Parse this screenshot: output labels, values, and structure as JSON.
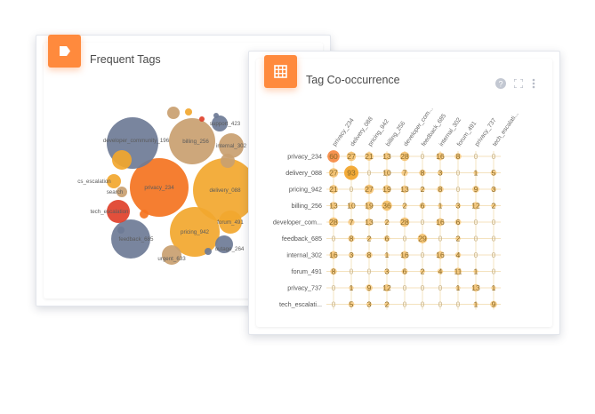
{
  "colors": {
    "accent": "#ff8a3d",
    "orange_deep": "#f4731f",
    "amber": "#f2a72e",
    "tan": "#c99f70",
    "slate": "#6e7b96",
    "red": "#e0402a"
  },
  "tags_card": {
    "title": "Frequent Tags",
    "icon": "tag-icon",
    "bubbles": [
      {
        "label": "privacy_234",
        "color": "orange_deep"
      },
      {
        "label": "delivery_088",
        "color": "amber"
      },
      {
        "label": "developer_community_196",
        "color": "slate"
      },
      {
        "label": "billing_256",
        "color": "tan"
      },
      {
        "label": "pricing_942",
        "color": "amber"
      },
      {
        "label": "feedback_685",
        "color": "slate"
      },
      {
        "label": "internal_302",
        "color": "tan"
      },
      {
        "label": "tech_escalation",
        "color": "red"
      },
      {
        "label": "forum_491",
        "color": "amber"
      },
      {
        "label": "cs_escalation",
        "color": "amber"
      },
      {
        "label": "search",
        "color": "tan"
      },
      {
        "label": "urgent_633",
        "color": "tan"
      },
      {
        "label": "support_423",
        "color": "slate"
      },
      {
        "label": "outage_264",
        "color": "slate"
      },
      {
        "label": "",
        "color": "amber"
      },
      {
        "label": "",
        "color": "tan"
      },
      {
        "label": "",
        "color": "amber"
      },
      {
        "label": "",
        "color": "slate"
      },
      {
        "label": "",
        "color": "red"
      },
      {
        "label": "",
        "color": "orange_deep"
      },
      {
        "label": "",
        "color": "slate"
      },
      {
        "label": "",
        "color": "tan"
      },
      {
        "label": "",
        "color": "slate"
      }
    ]
  },
  "cooc_card": {
    "title": "Tag Co-occurrence",
    "icon": "grid-icon",
    "toolbar": {
      "help_icon": "help-icon",
      "fullscreen_icon": "fullscreen-icon",
      "menu_icon": "more-vertical-icon"
    },
    "rows": [
      "privacy_234",
      "delivery_088",
      "pricing_942",
      "billing_256",
      "developer_com...",
      "feedback_685",
      "internal_302",
      "forum_491",
      "privacy_737",
      "tech_escalati..."
    ],
    "columns": [
      "privacy_234",
      "delivery_088",
      "pricing_942",
      "billing_256",
      "developer_com...",
      "feedback_685",
      "internal_302",
      "forum_491",
      "privacy_737",
      "tech_escalati..."
    ],
    "values": [
      [
        60,
        27,
        21,
        13,
        28,
        0,
        16,
        8,
        0,
        0
      ],
      [
        27,
        93,
        0,
        10,
        7,
        8,
        3,
        0,
        1,
        5
      ],
      [
        21,
        0,
        27,
        19,
        13,
        2,
        8,
        0,
        9,
        3
      ],
      [
        13,
        10,
        19,
        36,
        2,
        6,
        1,
        3,
        12,
        2
      ],
      [
        28,
        7,
        13,
        2,
        28,
        0,
        16,
        6,
        0,
        0
      ],
      [
        0,
        8,
        2,
        6,
        0,
        29,
        0,
        2,
        0,
        0
      ],
      [
        16,
        3,
        8,
        1,
        16,
        0,
        16,
        4,
        0,
        0
      ],
      [
        8,
        0,
        0,
        3,
        6,
        2,
        4,
        11,
        1,
        0
      ],
      [
        0,
        1,
        9,
        12,
        0,
        0,
        0,
        1,
        13,
        1
      ],
      [
        0,
        5,
        3,
        2,
        0,
        0,
        0,
        0,
        1,
        9
      ]
    ]
  }
}
